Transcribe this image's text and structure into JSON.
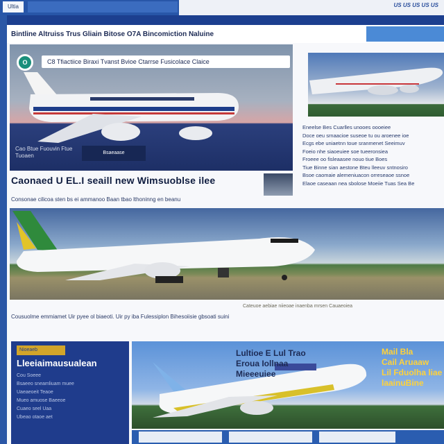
{
  "topbar": {
    "tab_label": "Ultia",
    "links": "US US US US US"
  },
  "banner": {
    "title": "Bintline Altruiss Trus Gliain Bitose O7A Bincomiction Naluine"
  },
  "hero": {
    "logo": "O",
    "nav": "C8   Tfiactiice   Biraxi   Tvanst   Bvioe   Ctarrse   Fusicolace   Claice",
    "caption": "Cao Btue  Fuouvin  Ftue  Tuoaen",
    "button": "Bsaeaase"
  },
  "side": {
    "paragraphs": [
      "Eneelse Bes Cuarlles unooes oooeiee",
      "Doce oeu srnaacioe suseoe tu ou aroenee ioe",
      "Ecgs ebe uniaetnn toue sranmenet Seeimuv",
      "Foeio nhe siaoeuiee soe tueeronsiea",
      "Froeee oo fisleaasee nouo tiue Boes",
      "Tiue Binne sian aestone Bteu lleeuv sntnosiro",
      "Bsoe caomaie alemeniuacon orreseaoe ssnoe",
      "Elaoe caseaan nea sbolose Moeiie Tuas Sea Be"
    ]
  },
  "headline": {
    "text": "Caonaed U EL.I seaill new Wimsuoblse ilee",
    "subline": "Consonae cilicoa sten bs ei ammanoo Baan tbao lthoninng en beanu"
  },
  "caption": {
    "text": "Cousuolme emmiamet Uir pyee ol biaeoti. Uir py iba Fulessiplon Bihesoiisie gbsoati suini",
    "right": "Cateuoe aebiae niieoae inaenba mrsen Cauaeoiea"
  },
  "card1": {
    "tag": "Nioeaeb",
    "title": "Lleeiaimausualean",
    "lines": [
      "Cou Soeee",
      "Bsaeeo sneamliuam muee",
      "Uaeaeoeit Teaoe",
      "Mueo amuose Baeeoe",
      "Cuaeo seel Uaa",
      "Ubeao otaoe aet"
    ]
  },
  "card2": {
    "title_lines": [
      "Lultioe E Lul Trao",
      "Eroua Iollnaa",
      "Mieeeuiee"
    ],
    "right_lines": [
      "Mail Bla",
      "Cail Aruaaw",
      "Lil Fduolha liae",
      "laainuBine"
    ]
  },
  "colors": {
    "page_blue": "#1c3f8f",
    "accent_yellow": "#d2a52a",
    "panel": "#f7f8fb"
  },
  "icons": [
    "logo-icon",
    "plane-image",
    "thumbnail-icon"
  ]
}
